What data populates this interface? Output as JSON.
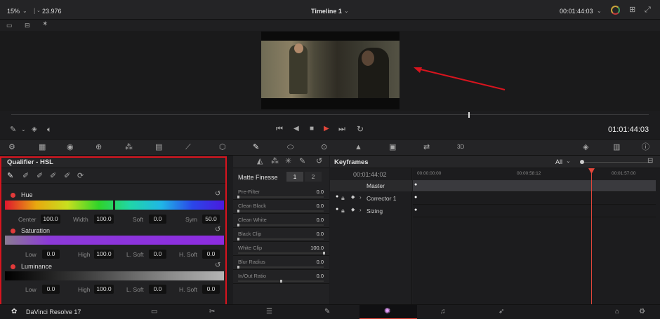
{
  "topbar": {
    "zoom": "15%",
    "fps": "23.976",
    "timeline_name": "Timeline 1",
    "timecode": "00:01:44:03"
  },
  "viewer": {
    "timecode": "01:01:44:03"
  },
  "qualifier": {
    "title": "Qualifier - HSL",
    "hue": {
      "label": "Hue",
      "center_label": "Center",
      "center": "100.0",
      "width_label": "Width",
      "width": "100.0",
      "soft_label": "Soft",
      "soft": "0.0",
      "sym_label": "Sym",
      "sym": "50.0"
    },
    "saturation": {
      "label": "Saturation",
      "low_label": "Low",
      "low": "0.0",
      "high_label": "High",
      "high": "100.0",
      "lsoft_label": "L. Soft",
      "lsoft": "0.0",
      "hsoft_label": "H. Soft",
      "hsoft": "0.0"
    },
    "luminance": {
      "label": "Luminance",
      "low_label": "Low",
      "low": "0.0",
      "high_label": "High",
      "high": "100.0",
      "lsoft_label": "L. Soft",
      "lsoft": "0.0",
      "hsoft_label": "H. Soft",
      "hsoft": "0.0"
    }
  },
  "matte": {
    "title": "Matte Finesse",
    "tab1": "1",
    "tab2": "2",
    "rows": [
      {
        "name": "Pre-Filter",
        "value": "0.0",
        "level": 0.0
      },
      {
        "name": "Clean Black",
        "value": "0.0",
        "level": 0.0
      },
      {
        "name": "Clean White",
        "value": "0.0",
        "level": 0.0
      },
      {
        "name": "Black Clip",
        "value": "0.0",
        "level": 0.0
      },
      {
        "name": "White Clip",
        "value": "100.0",
        "level": 1.0
      },
      {
        "name": "Blur Radius",
        "value": "0.0",
        "level": 0.0
      },
      {
        "name": "In/Out Ratio",
        "value": "0.0",
        "level": 0.5
      }
    ]
  },
  "keyframes": {
    "title": "Keyframes",
    "filter": "All",
    "timecode": "00:01:44:02",
    "ruler": [
      "00:00:00:00",
      "00:00:58:12",
      "00:01:57:00"
    ],
    "tracks": [
      "Master",
      "Corrector 1",
      "Sizing"
    ],
    "playhead_fraction": 0.734
  },
  "bottombar": {
    "app_name": "DaVinci Resolve 17"
  },
  "colors": {
    "accent_red": "#d8141e",
    "playhead": "#e2463a"
  }
}
